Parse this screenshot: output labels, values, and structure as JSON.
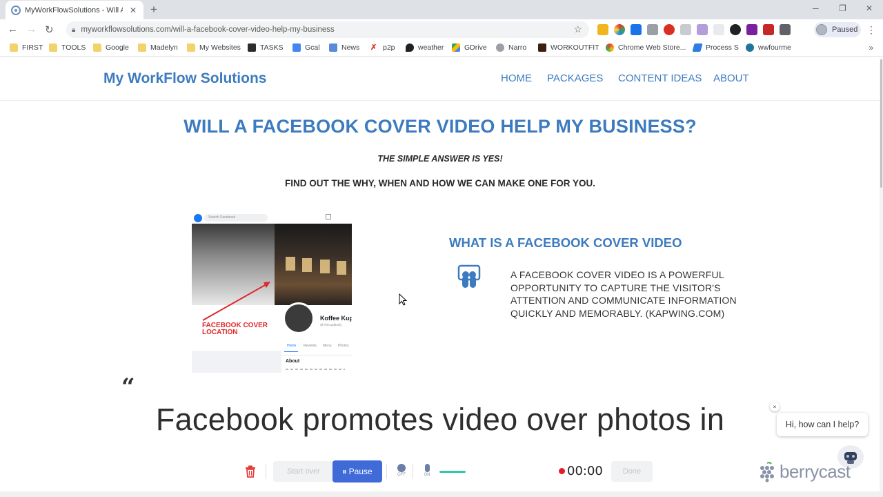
{
  "browser": {
    "tab_title": "MyWorkFlowSolutions - Will A Fa",
    "url": "myworkflowsolutions.com/will-a-facebook-cover-video-help-my-business",
    "profile_status": "Paused",
    "bookmarks": [
      "FIRST",
      "TOOLS",
      "Google",
      "Madelyn",
      "My Websites",
      "TASKS",
      "Gcal",
      "News",
      "p2p",
      "weather",
      "GDrive",
      "Narro",
      "WORKOUTFIT",
      "Chrome Web Store...",
      "Process S",
      "wwfourme"
    ],
    "bookmark_more": "»"
  },
  "site": {
    "title": "My WorkFlow Solutions",
    "nav": [
      "HOME",
      "PACKAGES",
      "CONTENT IDEAS",
      "ABOUT"
    ]
  },
  "content": {
    "heading": "WILL A FACEBOOK COVER VIDEO HELP MY BUSINESS?",
    "subtitle": "THE SIMPLE ANSWER IS YES!",
    "subtitle2": "FIND OUT THE WHY, WHEN AND HOW WE CAN MAKE ONE FOR YOU.",
    "image": {
      "search_placeholder": "Search Facebook",
      "page_name": "Koffee Kup",
      "handle": "@Thecupfamily",
      "tabs": [
        "Home",
        "Reviews",
        "Menu",
        "Photos"
      ],
      "about": "About",
      "label": "FACEBOOK COVER LOCATION"
    },
    "section_heading": "WHAT IS A FACEBOOK COVER VIDEO",
    "section_text": "A FACEBOOK COVER VIDEO IS A POWERFUL OPPORTUNITY TO CAPTURE THE VISITOR'S ATTENTION AND COMMUNICATE INFORMATION QUICKLY AND MEMORABLY. (KAPWING.COM)",
    "quote_mark": "“",
    "quote_text": "Facebook promotes video over photos in"
  },
  "chat": {
    "close": "×",
    "greeting": "Hi, how can I help?"
  },
  "recorder": {
    "start_over": "Start over",
    "pause": "⏸ Pause",
    "cam_label": "OFF",
    "mic_label": "ON",
    "time": "00:00",
    "done": "Done",
    "brand": "berrycast"
  },
  "colors": {
    "brand_blue": "#3c7bbf",
    "pause_button": "#3f6ad8",
    "recording_red": "#e11d2a",
    "annotation_red": "#e0262b"
  }
}
